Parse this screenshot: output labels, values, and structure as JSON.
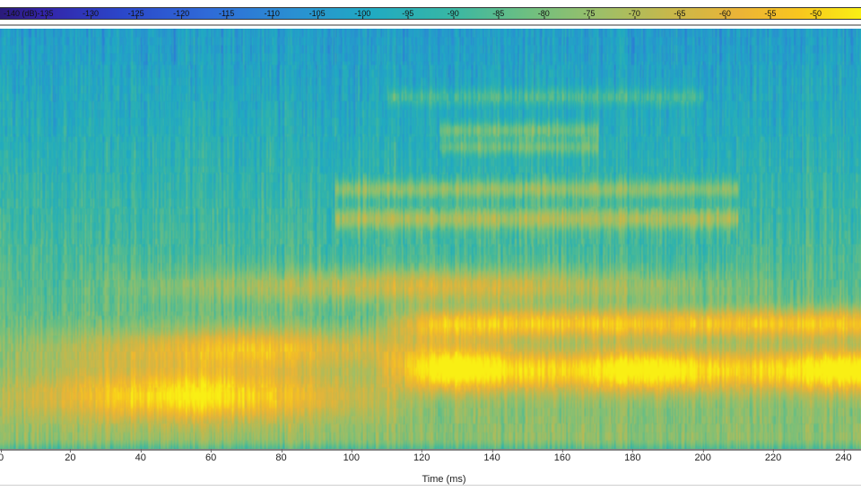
{
  "colorbar": {
    "unit_label": "-140 (dB)",
    "ticks": [
      "-135",
      "-130",
      "-125",
      "-120",
      "-115",
      "-110",
      "-105",
      "-100",
      "-95",
      "-90",
      "-85",
      "-80",
      "-75",
      "-70",
      "-65",
      "-60",
      "-55",
      "-50"
    ],
    "tick_values": [
      -135,
      -130,
      -125,
      -120,
      -115,
      -110,
      -105,
      -100,
      -95,
      -90,
      -85,
      -80,
      -75,
      -70,
      -65,
      -60,
      -55,
      -50
    ],
    "range_db": [
      -140,
      -45
    ],
    "colormap": [
      "#2a1a7a",
      "#3324a8",
      "#2b46c9",
      "#2f6ad8",
      "#2a8fd2",
      "#20aac3",
      "#36b6a6",
      "#6cbf82",
      "#9ebf67",
      "#c8b84a",
      "#ecb436",
      "#f8c71e",
      "#f9ef14"
    ]
  },
  "time_axis": {
    "label": "Time (ms)",
    "ticks": [
      "0",
      "20",
      "40",
      "60",
      "80",
      "100",
      "120",
      "140",
      "160",
      "180",
      "200",
      "220",
      "240"
    ],
    "tick_values": [
      0,
      20,
      40,
      60,
      80,
      100,
      120,
      140,
      160,
      180,
      200,
      220,
      240
    ],
    "range_ms": [
      0,
      245
    ]
  },
  "spectrogram": {
    "background_level_db": -100,
    "band_levels": [
      {
        "name": "band-low",
        "time_ms": [
          0,
          110
        ],
        "level_db": -55
      },
      {
        "name": "band-main",
        "time_ms": [
          110,
          245
        ],
        "level_db": -50
      },
      {
        "name": "band-mid",
        "time_ms": [
          20,
          245
        ],
        "level_db": -65
      },
      {
        "name": "band-upper",
        "time_ms": [
          110,
          200
        ],
        "level_db": -75
      }
    ]
  }
}
